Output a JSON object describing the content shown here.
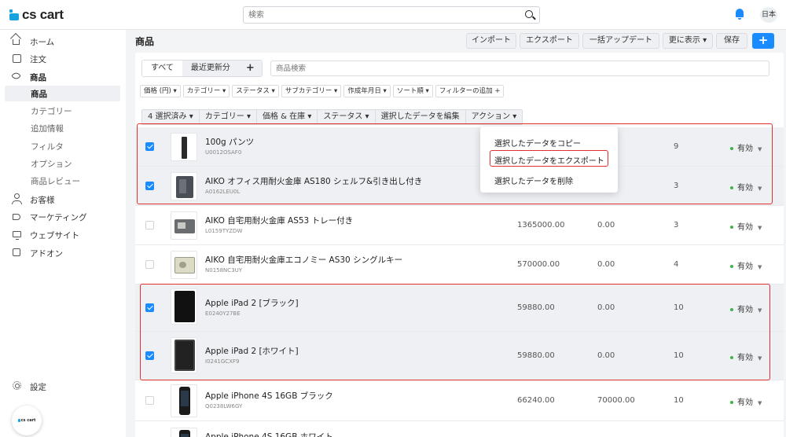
{
  "header": {
    "logo_text": "cs cart",
    "search_placeholder": "検索",
    "lang": "日本"
  },
  "sidebar": {
    "items": [
      {
        "label": "ホーム"
      },
      {
        "label": "注文"
      },
      {
        "label": "商品"
      },
      {
        "label": "商品"
      },
      {
        "label": "カテゴリー"
      },
      {
        "label": "追加情報"
      },
      {
        "label": "フィルタ"
      },
      {
        "label": "オプション"
      },
      {
        "label": "商品レビュー"
      },
      {
        "label": "お客様"
      },
      {
        "label": "マーケティング"
      },
      {
        "label": "ウェブサイト"
      },
      {
        "label": "アドオン"
      }
    ],
    "settings_label": "設定",
    "badge_text": "cs cart"
  },
  "main": {
    "title": "商品",
    "toolbar": {
      "import": "インポート",
      "export": "エクスポート",
      "bulk_update": "一括アップデート",
      "more": "更に表示",
      "save": "保存",
      "add": "+"
    },
    "tabs": [
      "すべて",
      "最近更新分",
      "+"
    ],
    "product_search_placeholder": "商品検索",
    "filters": [
      "価格 (円)",
      "カテゴリー",
      "ステータス",
      "サブカテゴリー",
      "作成年月日",
      "ソート順",
      "フィルターの追加 +"
    ],
    "bulk_actions": [
      "4 選択済み",
      "カテゴリー",
      "価格 & 在庫",
      "ステータス",
      "選択したデータを編集",
      "アクション"
    ],
    "action_menu": [
      "選択したデータをコピー",
      "選択したデータをエクスポート",
      "選択したデータを削除"
    ],
    "status_label": "有効",
    "products": [
      {
        "name": "100g パンツ",
        "code": "U0012OSAF0",
        "price": "",
        "list_price": "",
        "qty": "9",
        "selected": true
      },
      {
        "name": "AIKO オフィス用耐火金庫 AS180 シェルフ&引き出し付き",
        "code": "A0162LEU0L",
        "price": "",
        "list_price": "",
        "qty": "3",
        "selected": true
      },
      {
        "name": "AIKO 自宅用耐火金庫 AS53 トレー付き",
        "code": "L0159TYZDW",
        "price": "1365000.00",
        "list_price": "0.00",
        "qty": "3",
        "selected": false
      },
      {
        "name": "AIKO 自宅用耐火金庫エコノミー AS30 シングルキー",
        "code": "N0158NC3UY",
        "price": "570000.00",
        "list_price": "0.00",
        "qty": "4",
        "selected": false
      },
      {
        "name": "Apple iPad 2 [ブラック]",
        "code": "E0240Y27BE",
        "price": "59880.00",
        "list_price": "0.00",
        "qty": "10",
        "selected": true
      },
      {
        "name": "Apple iPad 2 [ホワイト]",
        "code": "I0241GCXF9",
        "price": "59880.00",
        "list_price": "0.00",
        "qty": "10",
        "selected": true
      },
      {
        "name": "Apple iPhone 4S 16GB ブラック",
        "code": "Q0238LW6GY",
        "price": "66240.00",
        "list_price": "70000.00",
        "qty": "10",
        "selected": false
      },
      {
        "name": "Apple iPhone 4S 16GB ホワイト",
        "code": "",
        "price": "",
        "list_price": "",
        "qty": "",
        "selected": false
      }
    ]
  },
  "colors": {
    "accent": "#1a8cff",
    "highlight_red": "#e03030",
    "status_green": "#3bb54a",
    "selected_row": "#eef0f4"
  }
}
